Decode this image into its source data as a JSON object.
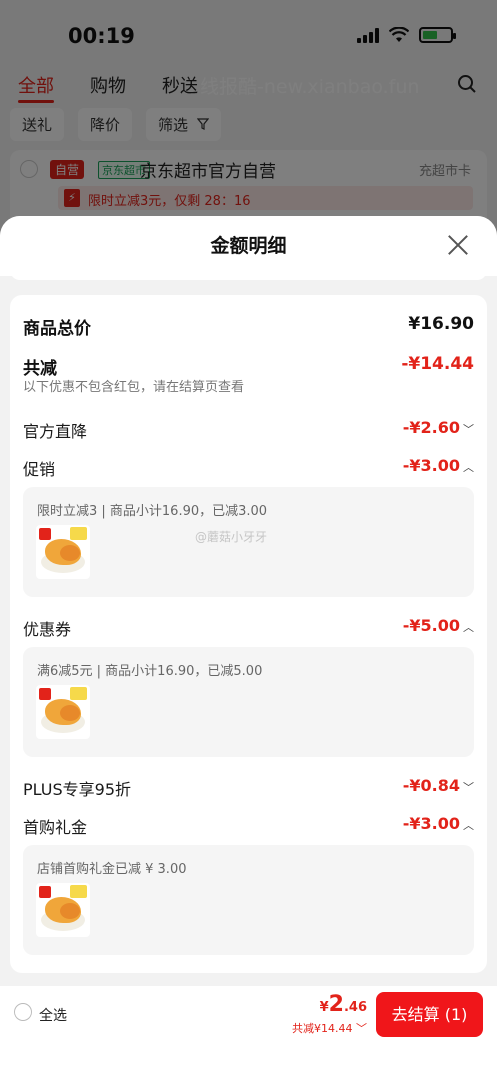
{
  "status_bar": {
    "time": "00:19"
  },
  "background": {
    "tabs": [
      "全部",
      "购物",
      "秒送"
    ],
    "watermark": "线报酷-new.xianbao.fun",
    "filters": [
      "送礼",
      "降价",
      "筛选"
    ],
    "store": {
      "self_tag": "自营",
      "jd_tag": "京东超市",
      "name": "京东超市官方自营",
      "link": "充超市卡",
      "promo": "限时立减3元，仅剩 28：16"
    }
  },
  "sheet": {
    "title": "金额明细",
    "total_label": "商品总价",
    "total_value": "¥16.90",
    "reduce_label": "共减",
    "reduce_value": "-¥14.44",
    "reduce_note": "以下优惠不包含红包，请在结算页查看",
    "official_label": "官方直降",
    "official_value": "-¥2.60",
    "promo_label": "促销",
    "promo_value": "-¥3.00",
    "promo_detail": "限时立减3 | 商品小计16.90，已减3.00",
    "coupon_label": "优惠券",
    "coupon_value": "-¥5.00",
    "coupon_detail": "满6减5元 | 商品小计16.90，已减5.00",
    "plus_label": "PLUS专享95折",
    "plus_value": "-¥0.84",
    "gift_label": "首购礼金",
    "gift_value": "-¥3.00",
    "gift_detail": "店铺首购礼金已减 ¥ 3.00",
    "weibo_watermark": "@蘑菇小牙牙"
  },
  "footer": {
    "select_all": "全选",
    "price_symbol": "¥",
    "price_int": "2",
    "price_dec": ".46",
    "price_sub": "共减¥14.44",
    "checkout": "去结算 (1)"
  },
  "colors": {
    "accent": "#e2231a",
    "button": "#f0161a"
  },
  "icons": [
    "signal-icon",
    "wifi-icon",
    "battery-icon",
    "search-icon",
    "filter-icon",
    "close-icon",
    "chevron-down-icon",
    "chevron-up-icon"
  ]
}
